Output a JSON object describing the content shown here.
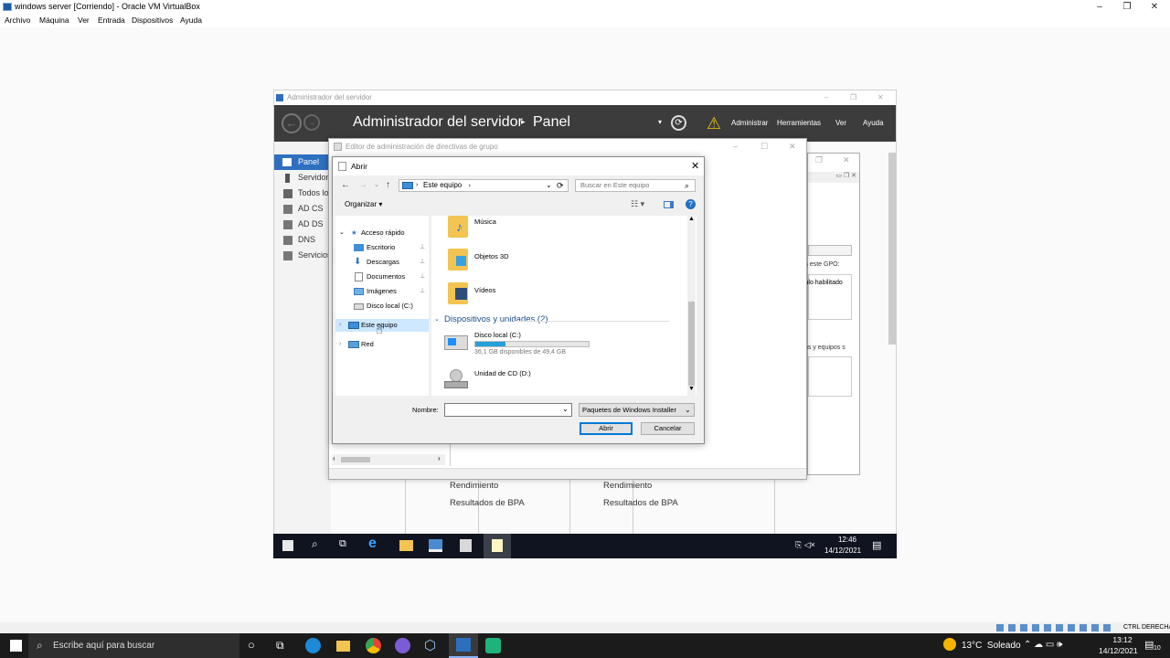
{
  "virtualbox": {
    "title": "windows server [Corriendo] - Oracle VM VirtualBox",
    "menu": [
      "Archivo",
      "Máquina",
      "Ver",
      "Entrada",
      "Dispositivos",
      "Ayuda"
    ],
    "host_key": "CTRL DERECHA"
  },
  "server_manager": {
    "window_title": "Administrador del servidor",
    "header_title": "Administrador del servidor",
    "header_page": "Panel",
    "header_menu": [
      "Administrar",
      "Herramientas",
      "Ver",
      "Ayuda"
    ],
    "nav": [
      "Panel",
      "Servidor",
      "Todos lo",
      "AD CS",
      "AD DS",
      "DNS",
      "Servicios"
    ],
    "tiles_left": [
      "Rendimiento",
      "Resultados de BPA"
    ],
    "tiles_right": [
      "Rendimiento",
      "Resultados de BPA"
    ],
    "side_texts": [
      "a este GPO:",
      "culo habilitado",
      "os y equipos s"
    ]
  },
  "gpo_editor": {
    "title": "Editor de administración de directivas de grupo"
  },
  "open_dialog": {
    "title": "Abrir",
    "address": "Este equipo",
    "search_placeholder": "Buscar en Este equipo",
    "organize": "Organizar",
    "nav": {
      "quick_access": "Acceso rápido",
      "items": [
        "Escritorio",
        "Descargas",
        "Documentos",
        "Imágenes",
        "Disco local (C:)"
      ],
      "this_pc": "Este equipo",
      "network": "Red"
    },
    "folders": [
      "Música",
      "Objetos 3D",
      "Vídeos"
    ],
    "devices_header": "Dispositivos y unidades (2)",
    "drive_c": {
      "name": "Disco local (C:)",
      "free": "36,1 GB disponibles de 49,4 GB",
      "used_fraction": 0.27
    },
    "drive_d": {
      "name": "Unidad de CD (D:)"
    },
    "filename_label": "Nombre:",
    "filetype": "Paquetes de Windows Installer",
    "open_button": "Abrir",
    "cancel_button": "Cancelar"
  },
  "vm_taskbar": {
    "time": "12:46",
    "date": "14/12/2021"
  },
  "host_taskbar": {
    "search_placeholder": "Escribe aquí para buscar",
    "weather": "13°C  Soleado",
    "time": "13:12",
    "date": "14/12/2021",
    "notification_count": "10"
  }
}
